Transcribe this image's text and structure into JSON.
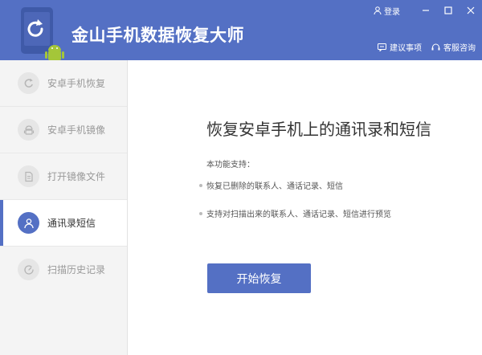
{
  "app": {
    "title": "金山手机数据恢复大师"
  },
  "header": {
    "login_label": "登录",
    "feedback_label": "建议事项",
    "support_label": "客服咨询"
  },
  "sidebar": {
    "items": [
      {
        "label": "安卓手机恢复",
        "icon": "refresh-icon",
        "active": false
      },
      {
        "label": "安卓手机镜像",
        "icon": "android-icon",
        "active": false
      },
      {
        "label": "打开镜像文件",
        "icon": "document-icon",
        "active": false
      },
      {
        "label": "通讯录短信",
        "icon": "contact-icon",
        "active": true
      },
      {
        "label": "扫描历史记录",
        "icon": "history-icon",
        "active": false
      }
    ]
  },
  "main": {
    "title": "恢复安卓手机上的通讯录和短信",
    "features_label": "本功能支持：",
    "features": [
      "恢复已删除的联系人、通话记录、短信",
      "支持对扫描出来的联系人、通话记录、短信进行预览"
    ],
    "start_button": "开始恢复"
  },
  "colors": {
    "accent": "#5470c4",
    "sidebar_bg": "#f4f4f4",
    "text_dark": "#333333",
    "text_muted": "#999999"
  }
}
